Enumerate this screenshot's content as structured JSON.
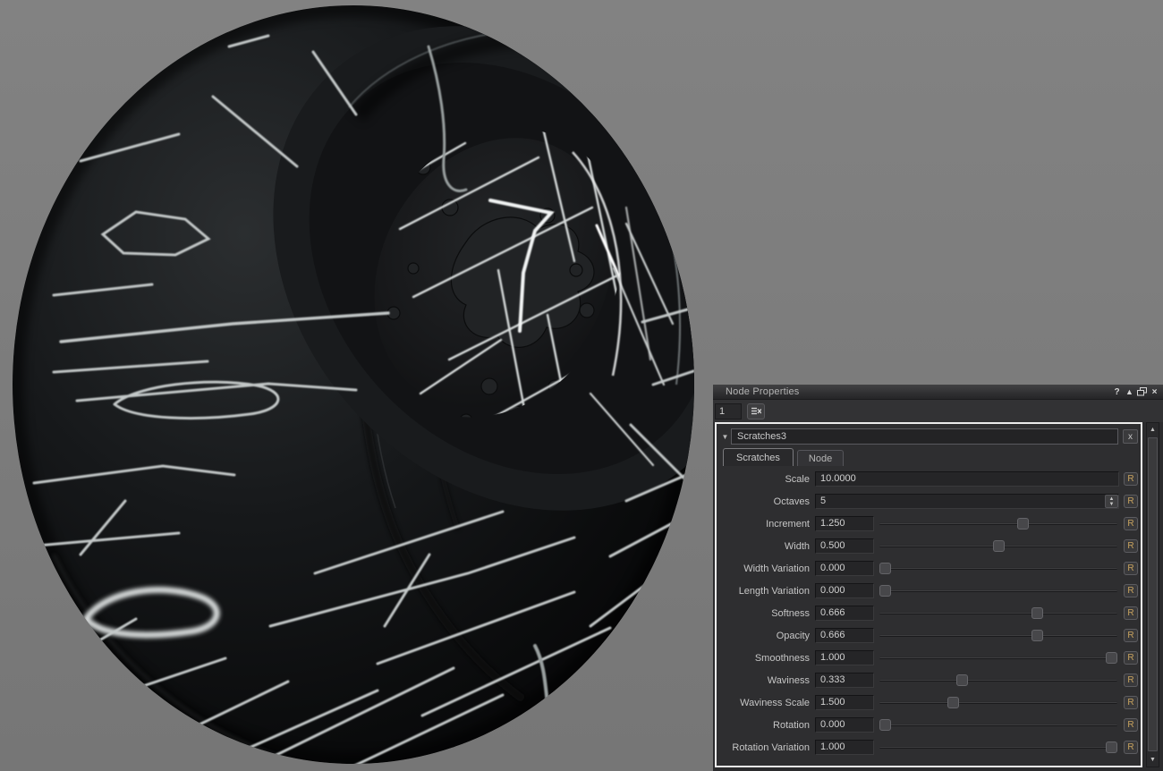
{
  "viewport": {
    "background_color": "#7d7d7d",
    "object": "shader-ball preview",
    "material_base_color": "#0d0e0f",
    "scratch_color": "#e8eaea"
  },
  "panel": {
    "title": "Node Properties",
    "icons": {
      "help": "?",
      "triangle": "▲",
      "close": "×",
      "collapse": "▼",
      "spin_up": "▲",
      "spin_down": "▼",
      "scroll_up": "▲",
      "scroll_down": "▼",
      "section_close": "x"
    },
    "toolbar": {
      "index_value": "1"
    },
    "section_name": "Scratches3",
    "tabs": [
      {
        "label": "Scratches",
        "active": true
      },
      {
        "label": "Node",
        "active": false
      }
    ],
    "reset_label": "R",
    "params": [
      {
        "label": "Scale",
        "value": "10.0000",
        "control": "text"
      },
      {
        "label": "Octaves",
        "value": "5",
        "control": "spinner"
      },
      {
        "label": "Increment",
        "value": "1.250",
        "control": "slider",
        "fraction": 0.61
      },
      {
        "label": "Width",
        "value": "0.500",
        "control": "slider",
        "fraction": 0.5
      },
      {
        "label": "Width Variation",
        "value": "0.000",
        "control": "slider",
        "fraction": 0.0
      },
      {
        "label": "Length Variation",
        "value": "0.000",
        "control": "slider",
        "fraction": 0.0
      },
      {
        "label": "Softness",
        "value": "0.666",
        "control": "slider",
        "fraction": 0.67
      },
      {
        "label": "Opacity",
        "value": "0.666",
        "control": "slider",
        "fraction": 0.67
      },
      {
        "label": "Smoothness",
        "value": "1.000",
        "control": "slider",
        "fraction": 1.0
      },
      {
        "label": "Waviness",
        "value": "0.333",
        "control": "slider",
        "fraction": 0.34
      },
      {
        "label": "Waviness Scale",
        "value": "1.500",
        "control": "slider",
        "fraction": 0.3
      },
      {
        "label": "Rotation",
        "value": "0.000",
        "control": "slider",
        "fraction": 0.0
      },
      {
        "label": "Rotation Variation",
        "value": "1.000",
        "control": "slider",
        "fraction": 1.0
      }
    ]
  }
}
